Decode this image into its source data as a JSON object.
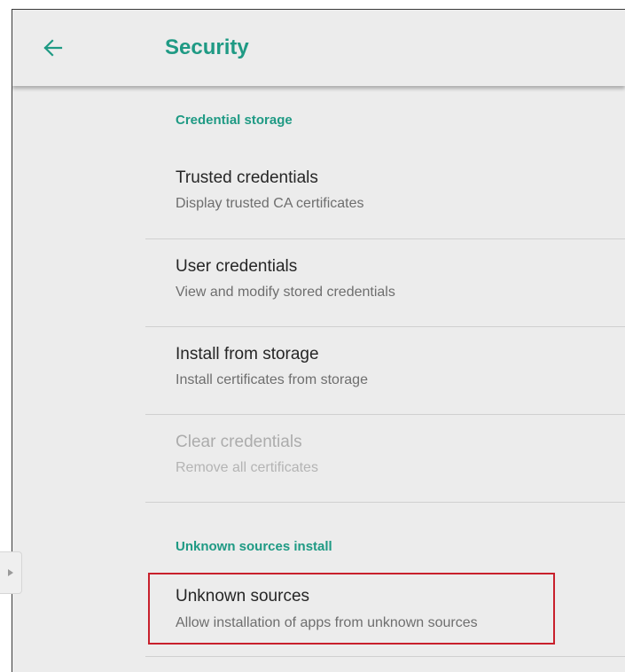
{
  "header": {
    "title": "Security",
    "back_icon": "arrow-back-icon"
  },
  "sections": {
    "credential_storage": {
      "header": "Credential storage",
      "items": [
        {
          "title": "Trusted credentials",
          "summary": "Display trusted CA certificates",
          "enabled": true
        },
        {
          "title": "User credentials",
          "summary": "View and modify stored credentials",
          "enabled": true
        },
        {
          "title": "Install from storage",
          "summary": "Install certificates from storage",
          "enabled": true
        },
        {
          "title": "Clear credentials",
          "summary": "Remove all certificates",
          "enabled": false
        }
      ]
    },
    "unknown_sources_install": {
      "header": "Unknown sources install",
      "items": [
        {
          "title": "Unknown sources",
          "summary": "Allow installation of apps from unknown sources",
          "enabled": true,
          "highlighted": true
        }
      ]
    }
  },
  "side_panel": {
    "icon": "triangle-right-icon"
  },
  "colors": {
    "accent": "#1f9a84",
    "background": "#ececec",
    "highlight": "#c8202c"
  }
}
